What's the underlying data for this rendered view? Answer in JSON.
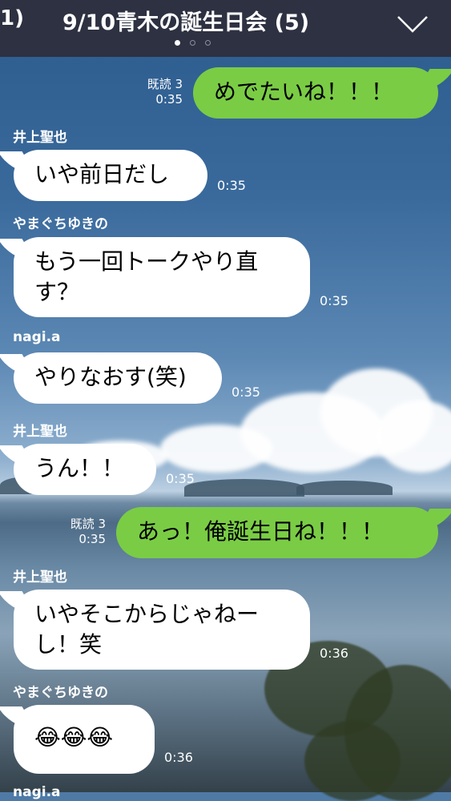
{
  "header": {
    "back_fragment": "1)",
    "title": "9/10青木の誕生日会 (5)"
  },
  "messages": [
    {
      "side": "right",
      "read": "既読 3",
      "time": "0:35",
      "text": "めでたいね！！！"
    },
    {
      "side": "left",
      "sender": "井上聖也",
      "time": "0:35",
      "text": "いや前日だし"
    },
    {
      "side": "left",
      "sender": "やまぐちゆきの",
      "time": "0:35",
      "text": "もう一回トークやり直す？"
    },
    {
      "side": "left",
      "sender": "nagi.a",
      "time": "0:35",
      "text": "やりなおす(笑)"
    },
    {
      "side": "left",
      "sender": "井上聖也",
      "time": "0:35",
      "text": "うん！！"
    },
    {
      "side": "right",
      "read": "既読 3",
      "time": "0:35",
      "text": "あっ！俺誕生日ね！！！"
    },
    {
      "side": "left",
      "sender": "井上聖也",
      "time": "0:36",
      "text": "いやそこからじゃねーし！笑"
    },
    {
      "side": "left",
      "sender": "やまぐちゆきの",
      "time": "0:36",
      "text": "😂😂😂"
    },
    {
      "side": "left",
      "sender": "nagi.a",
      "time": "",
      "text": ""
    }
  ],
  "colors": {
    "header": "#2d3141",
    "sent_bubble": "#7acc45",
    "received_bubble": "#ffffff"
  },
  "icons": {
    "dropdown": "chevron-down-icon"
  }
}
